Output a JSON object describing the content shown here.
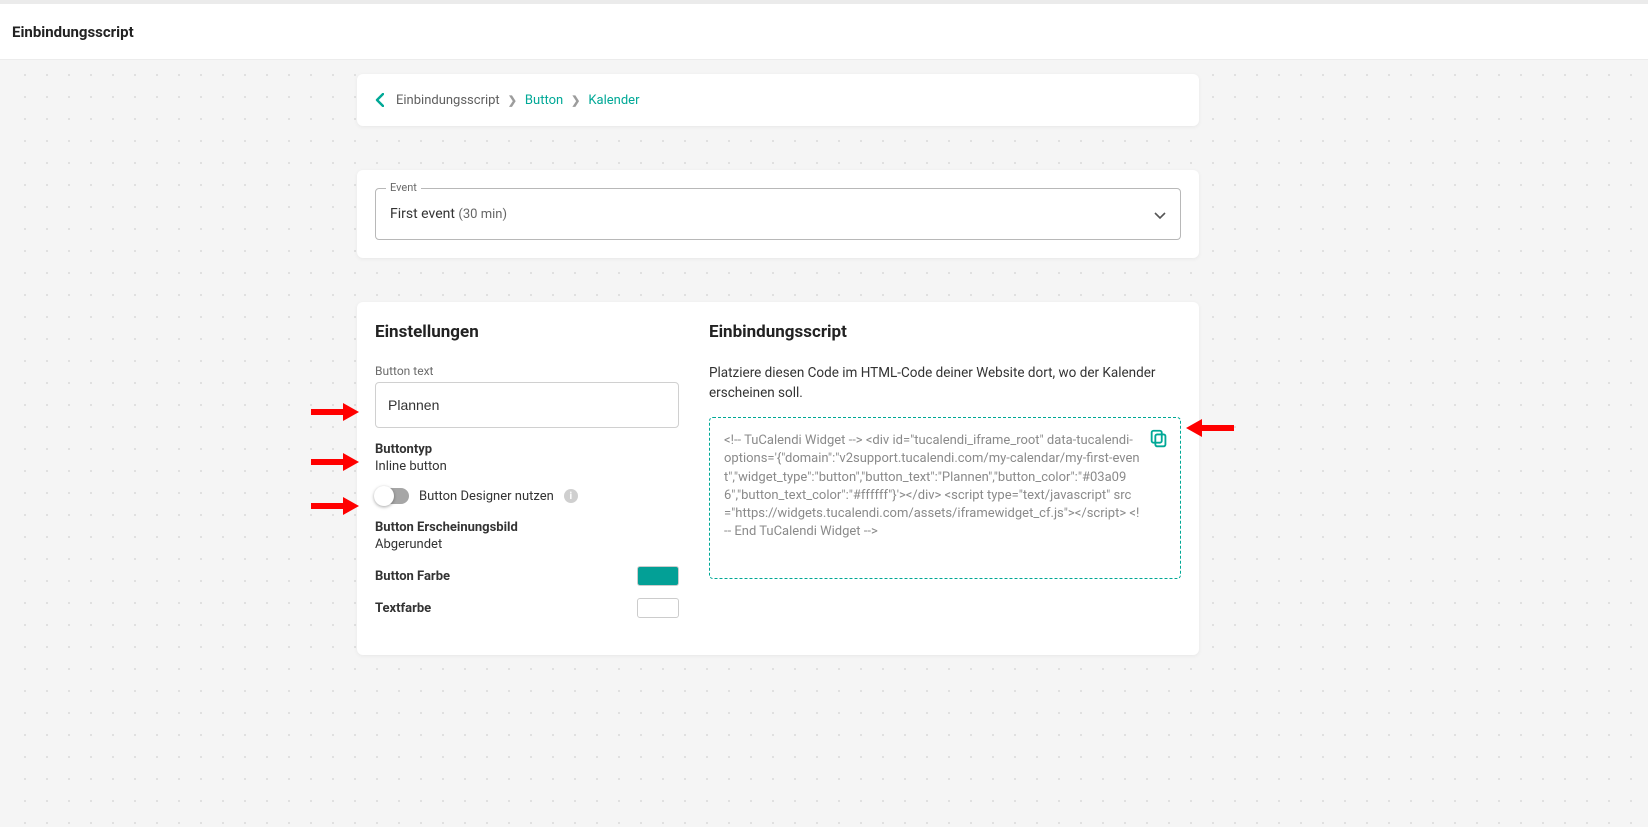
{
  "header": {
    "title": "Einbindungsscript"
  },
  "breadcrumb": {
    "items": [
      "Einbindungsscript",
      "Button",
      "Kalender"
    ]
  },
  "event_select": {
    "label": "Event",
    "value_name": "First event",
    "value_detail": "(30 min)"
  },
  "settings": {
    "title": "Einstellungen",
    "button_text_label": "Button text",
    "button_text_value": "Plannen",
    "button_type_label": "Buttontyp",
    "button_type_value": "Inline button",
    "designer_toggle_label": "Button Designer nutzen",
    "appearance_label": "Button Erscheinungsbild",
    "appearance_value": "Abgerundet",
    "button_color_label": "Button Farbe",
    "button_color_value": "#03a096",
    "text_color_label": "Textfarbe",
    "text_color_value": "#ffffff"
  },
  "embed": {
    "title": "Einbindungsscript",
    "description": "Platziere diesen Code im HTML-Code deiner Website dort, wo der Kalender erscheinen soll.",
    "code": "<!-- TuCalendi Widget -->\n<div id=\"tucalendi_iframe_root\" data-tucalendi-options='{\"domain\":\"v2support.tucalendi.com/my-calendar/my-first-event\",\"widget_type\":\"button\",\"button_text\":\"Plannen\",\"button_color\":\"#03a096\",\"button_text_color\":\"#ffffff\"}'></div>\n<script type=\"text/javascript\" src=\"https://widgets.tucalendi.com/assets/iframewidget_cf.js\"></script>\n<!-- End TuCalendi Widget -->"
  }
}
